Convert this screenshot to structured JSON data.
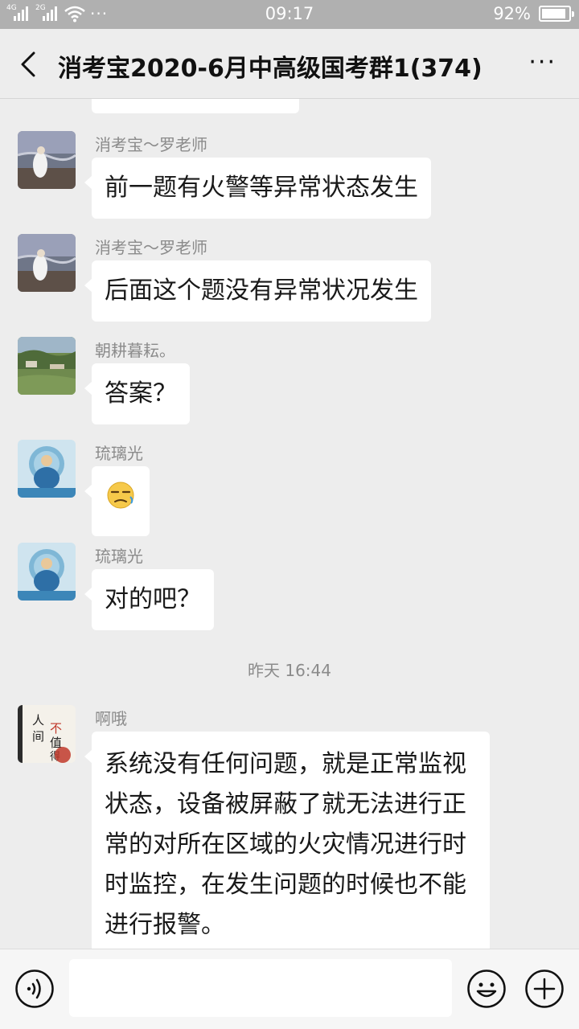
{
  "status_bar": {
    "signal_1_label": "4G",
    "signal_2_label": "2G",
    "more_dots": "···",
    "time": "09:17",
    "battery_text": "92%",
    "battery_level": 0.92
  },
  "header": {
    "title": "消考宝2020-6月中高级国考群1(374)",
    "back_icon": "chevron-left-icon",
    "more_icon": "ellipsis-icon",
    "more_label": "···"
  },
  "messages": [
    {
      "sender": "消考宝～罗老师",
      "text": "前一题有火警等异常状态发生",
      "avatar": "beach-figure-avatar"
    },
    {
      "sender": "消考宝～罗老师",
      "text": "后面这个题没有异常状况发生",
      "avatar": "beach-figure-avatar"
    },
    {
      "sender": "朝耕暮耘。",
      "text": "答案？",
      "avatar": "landscape-avatar"
    },
    {
      "sender": "琉璃光",
      "text": "😒",
      "avatar": "buddha-avatar"
    },
    {
      "sender": "琉璃光",
      "text": "对的吧？",
      "avatar": "buddha-avatar"
    },
    {
      "sender": "啊哦",
      "text": "系统没有任何问题，就是正常监视状态，设备被屏蔽了就无法进行正常的对所在区域的火灾情况进行时时监控，在发生问题的时候也不能进行报警。",
      "avatar": "book-cover-avatar",
      "avatar_text": [
        "人",
        "间",
        "不",
        "值",
        "得"
      ]
    }
  ],
  "timestamp": "昨天 16:44",
  "input_bar": {
    "voice_icon": "voice-icon",
    "emoji_icon": "emoji-icon",
    "plus_icon": "plus-icon",
    "text_value": ""
  }
}
